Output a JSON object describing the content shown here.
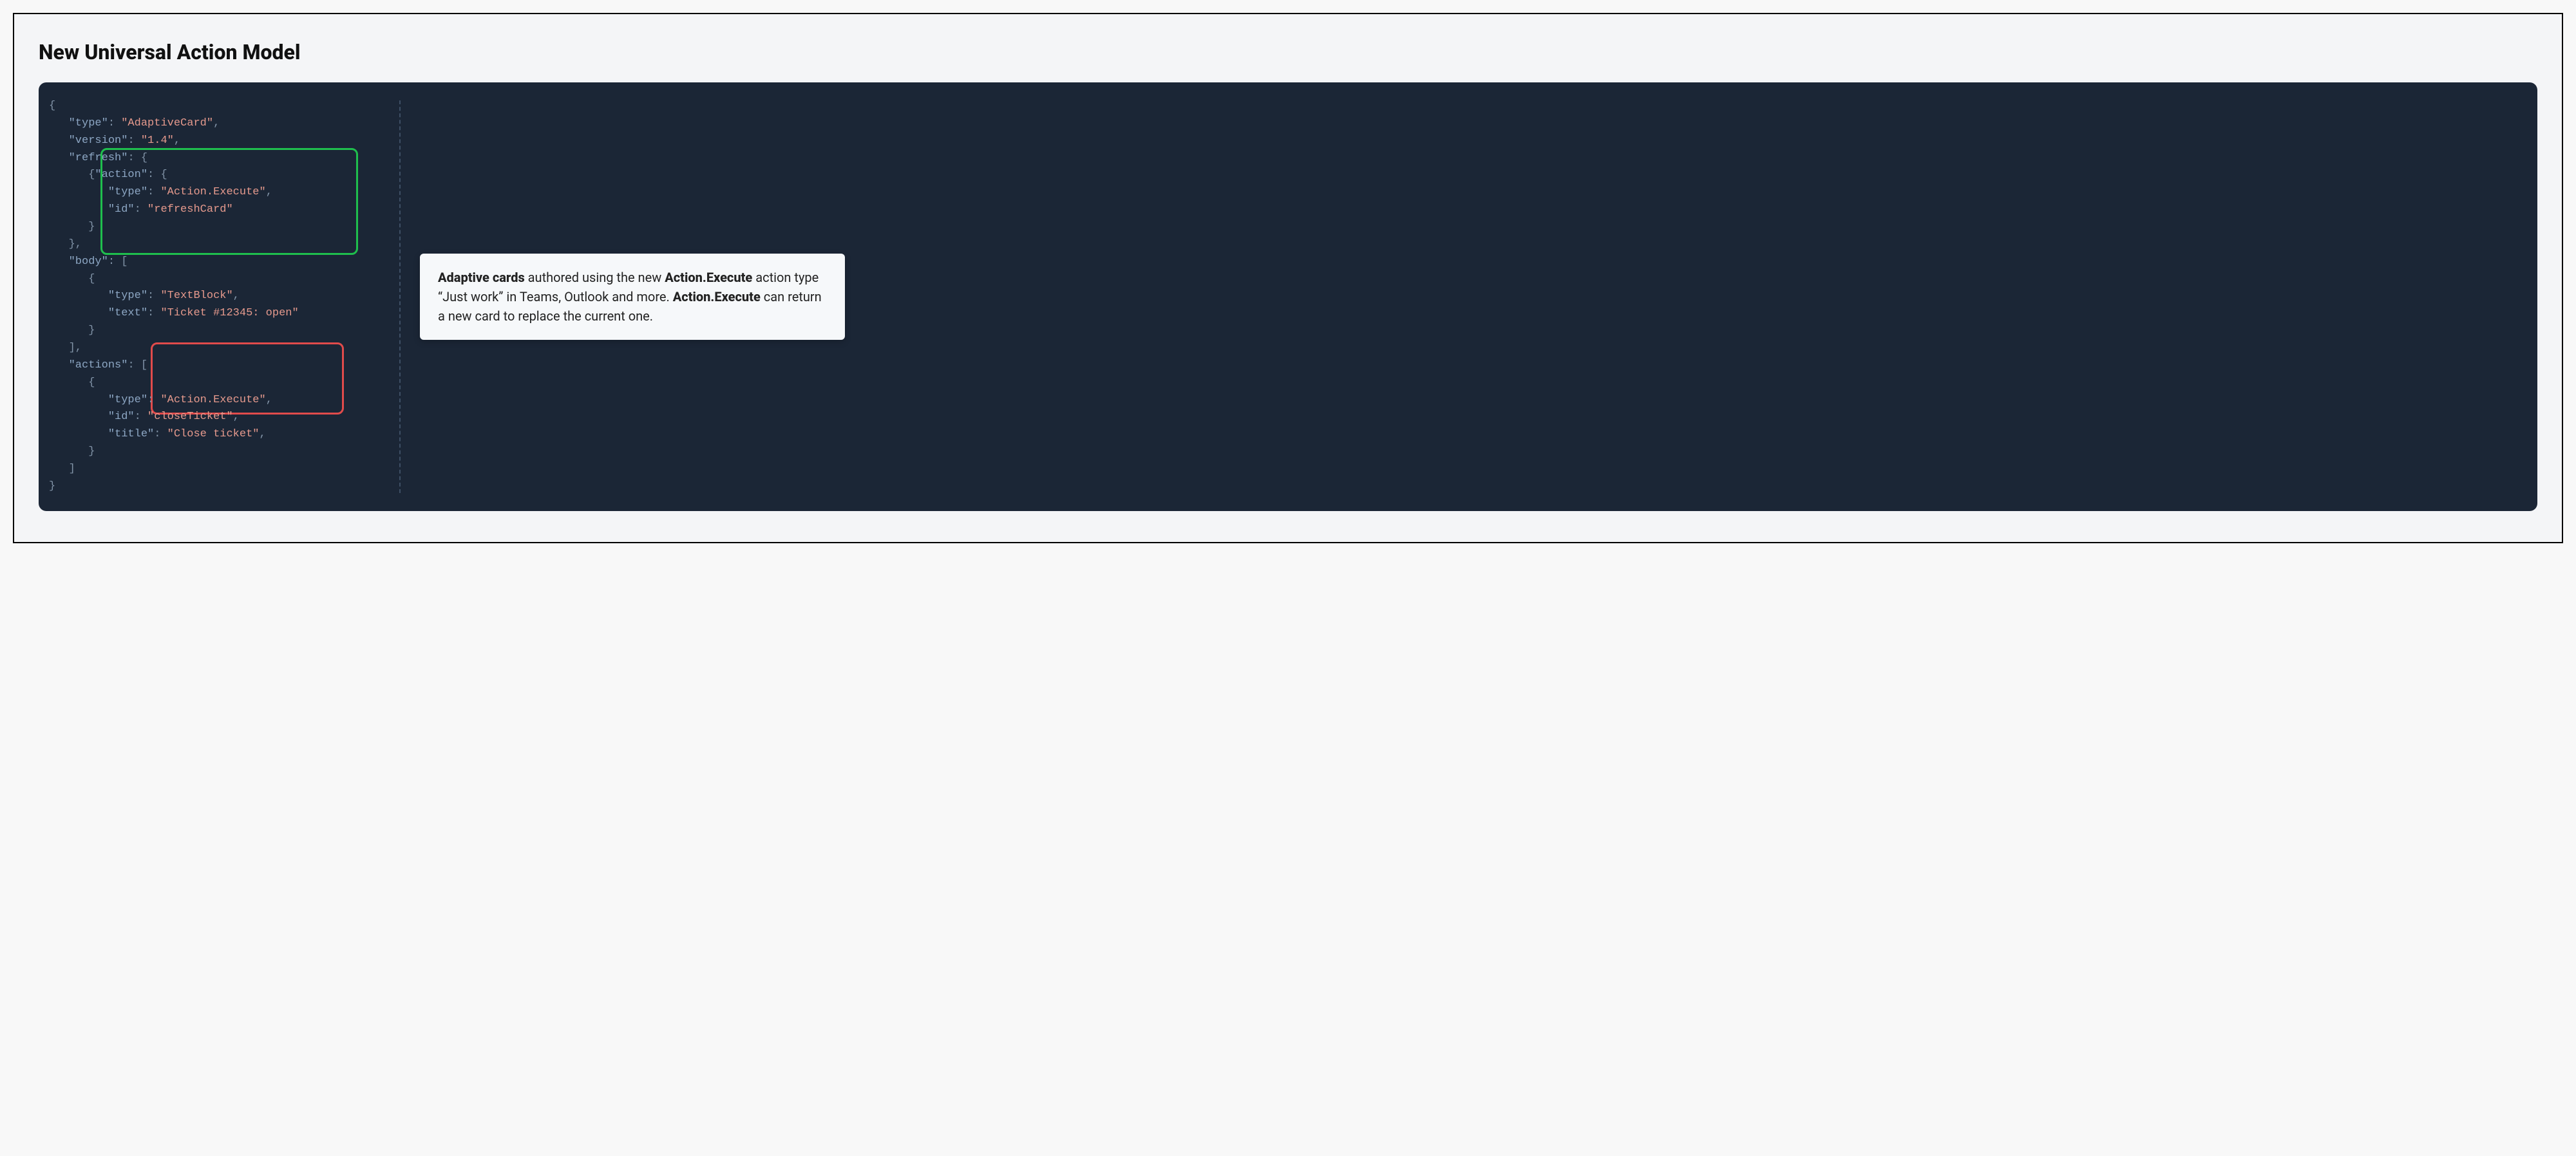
{
  "title": "New Universal Action Model",
  "code": {
    "l1": "{",
    "l2a": "\"type\"",
    "l2b": "\"AdaptiveCard\"",
    "l3a": "\"version\"",
    "l3b": "\"1.4\"",
    "l4a": "\"refresh\"",
    "l5a": "\"action\"",
    "l6a": "\"type\"",
    "l6b": "\"Action.Execute\"",
    "l7a": "\"id\"",
    "l7b": "\"refreshCard\"",
    "l8": "}",
    "l9": "},",
    "l10a": "\"body\"",
    "l11": "{",
    "l12a": "\"type\"",
    "l12b": "\"TextBlock\"",
    "l13a": "\"text\"",
    "l13b": "\"Ticket #12345: open\"",
    "l14": "}",
    "l15": "],",
    "l16a": "\"actions\"",
    "l17": "{",
    "l18a": "\"type\"",
    "l18b": "\"Action.Execute\"",
    "l19a": "\"id\"",
    "l19b": "\"closeTicket\"",
    "l20a": "\"title\"",
    "l20b": "\"Close ticket\"",
    "l21": "}",
    "l22": "]",
    "l23": "}"
  },
  "callout": {
    "b1": "Adaptive cards",
    "t1": " authored using the new ",
    "b2": "Action.Execute",
    "t2": " action type “Just work” in Teams, Outlook and more. ",
    "b3": "Action.Execute",
    "t3": " can return a new card to replace the current one."
  }
}
